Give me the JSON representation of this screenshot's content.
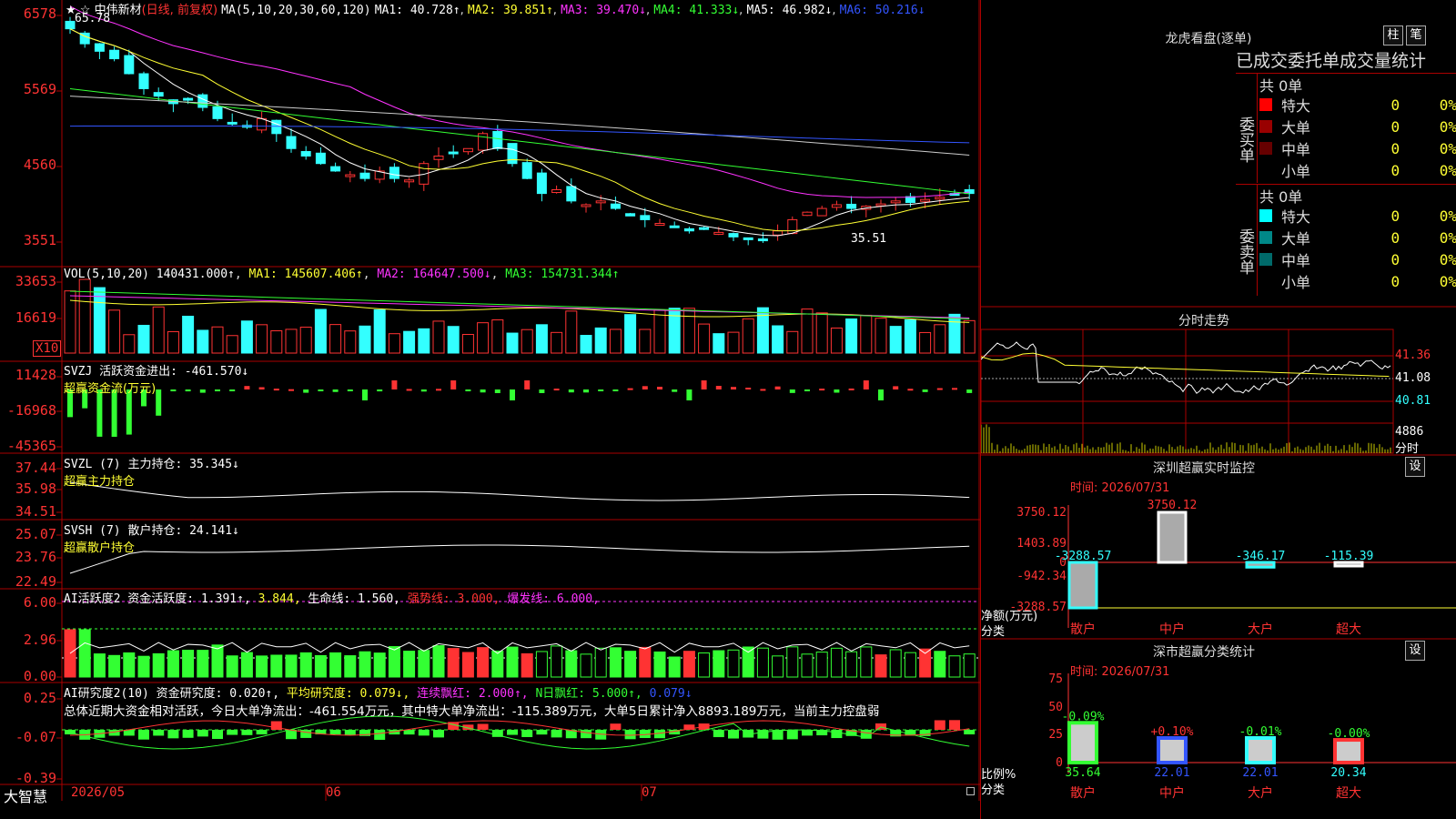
{
  "stock": {
    "name": "中伟新材",
    "period": "(日线, 前复权)"
  },
  "main_header": {
    "ma_param": "MA(5,10,20,30,60,120)",
    "ma1": "MA1: 40.728↑",
    "ma2": "MA2: 39.851↑",
    "ma3": "MA3: 39.470↓",
    "ma4": "MA4: 41.333↓",
    "ma5": "MA5: 46.982↓",
    "ma6": "MA6: 50.216↓"
  },
  "price_axis": [
    "6578",
    "5569",
    "4560",
    "3551"
  ],
  "price_marks": {
    "high": "65.78",
    "low": "35.51"
  },
  "vol_header": {
    "param": "VOL(5,10,20)",
    "vol": "140431.000↑",
    "ma1": "MA1: 145607.406↑",
    "ma2": "MA2: 164647.500↓",
    "ma3": "MA3: 154731.344↑"
  },
  "vol_axis": [
    "33653",
    "16619"
  ],
  "vol_unit": "X10",
  "svzj": {
    "line1": "SVZJ  活跃资金进出: -461.570↓",
    "line2": "超赢资金流(万元)",
    "axis": [
      "11428",
      "-16968",
      "-45365"
    ]
  },
  "svzl": {
    "line1": "SVZL (7) 主力持仓: 35.345↓",
    "line2": "超赢主力持仓",
    "axis": [
      "37.44",
      "35.98",
      "34.51"
    ]
  },
  "svsh": {
    "line1": "SVSH (7) 散户持仓: 24.141↓",
    "line2": "超赢散户持仓",
    "axis": [
      "25.07",
      "23.76",
      "22.49"
    ]
  },
  "ai1": {
    "a": "AI活跃度2 资金活跃度: 1.391↑,",
    "b": "3.844,",
    "c": "生命线: 1.560,",
    "d": "强势线: 3.000,",
    "e": "爆发线: 6.000,",
    "axis": [
      "6.00",
      "2.96",
      "0.00"
    ]
  },
  "ai2": {
    "a": "AI研究度2(10) 资金研究度: 0.020↑,",
    "b": "平均研究度: 0.079↓,",
    "c": "连续飘红: 2.000↑,",
    "d": "N日飘红: 5.000↑,",
    "e": "0.079↓",
    "axis": [
      "0.25",
      "-0.07",
      "-0.39"
    ]
  },
  "summary": "总体近期大资金相对活跃，今日大单净流出：-461.554万元，其中特大单净流出：-115.389万元，大单5日累计净入8893.189万元，当前主力控盘弱",
  "dates": [
    "2026/05",
    "06",
    "07"
  ],
  "brand": "大智慧",
  "right": {
    "lhb_title": "龙虎看盘(逐单)",
    "btn_zhu": "柱",
    "btn_bi": "笔",
    "stat_title": "已成交委托单成交量统计",
    "buy_label": "委买单",
    "sell_label": "委卖单",
    "buy_total": "共 0单",
    "sell_total": "共 0单",
    "buy_rows": [
      {
        "name": "特大",
        "qty": "0",
        "pct": "0%",
        "color": "#ff0000"
      },
      {
        "name": "大单",
        "qty": "0",
        "pct": "0%",
        "color": "#990000"
      },
      {
        "name": "中单",
        "qty": "0",
        "pct": "0%",
        "color": "#660000"
      },
      {
        "name": "小单",
        "qty": "0",
        "pct": "0%",
        "color": ""
      }
    ],
    "sell_rows": [
      {
        "name": "特大",
        "qty": "0",
        "pct": "0%",
        "color": "#00ffff"
      },
      {
        "name": "大单",
        "qty": "0",
        "pct": "0%",
        "color": "#008888"
      },
      {
        "name": "中单",
        "qty": "0",
        "pct": "0%",
        "color": "#006a6a"
      },
      {
        "name": "小单",
        "qty": "0",
        "pct": "0%",
        "color": ""
      }
    ],
    "fenshi_title": "分时走势",
    "fenshi_axis": [
      "41.36",
      "41.08",
      "40.81"
    ],
    "fenshi_vol": "4886",
    "fenshi_unit": "分时",
    "monitor_title": "深圳超赢实时监控",
    "monitor_btn": "设",
    "monitor_time": "时间: 2026/07/31",
    "monitor_axis": [
      "3750.12",
      "1403.89",
      "0",
      "-942.34",
      "-3288.57"
    ],
    "monitor_ylabel": "净额(万元)",
    "monitor_xlabel": "分类",
    "monitor_values": [
      {
        "label": "-3288.57",
        "value": -3288.57
      },
      {
        "label": "3750.12",
        "value": 3750.12
      },
      {
        "label": "-346.17",
        "value": -346.17
      },
      {
        "label": "-115.39",
        "value": -115.39
      }
    ],
    "categories": [
      "散户",
      "中户",
      "大户",
      "超大"
    ],
    "class_title": "深市超赢分类统计",
    "class_btn": "设",
    "class_time": "时间: 2026/07/31",
    "class_axis": [
      "75",
      "50",
      "25",
      "0"
    ],
    "class_ylabel": "比例%",
    "class_xlabel": "分类",
    "class_values": [
      {
        "top": "-0.09%",
        "bottom": "35.64",
        "value": 35.64
      },
      {
        "top": "+0.10%",
        "bottom": "22.01",
        "value": 22.01
      },
      {
        "top": "-0.01%",
        "bottom": "22.01",
        "value": 22.01
      },
      {
        "top": "-0.00%",
        "bottom": "20.34",
        "value": 20.34
      }
    ]
  },
  "colors": {
    "grid": "#aa0000",
    "up": "#ff3333",
    "down": "#33ffff"
  }
}
